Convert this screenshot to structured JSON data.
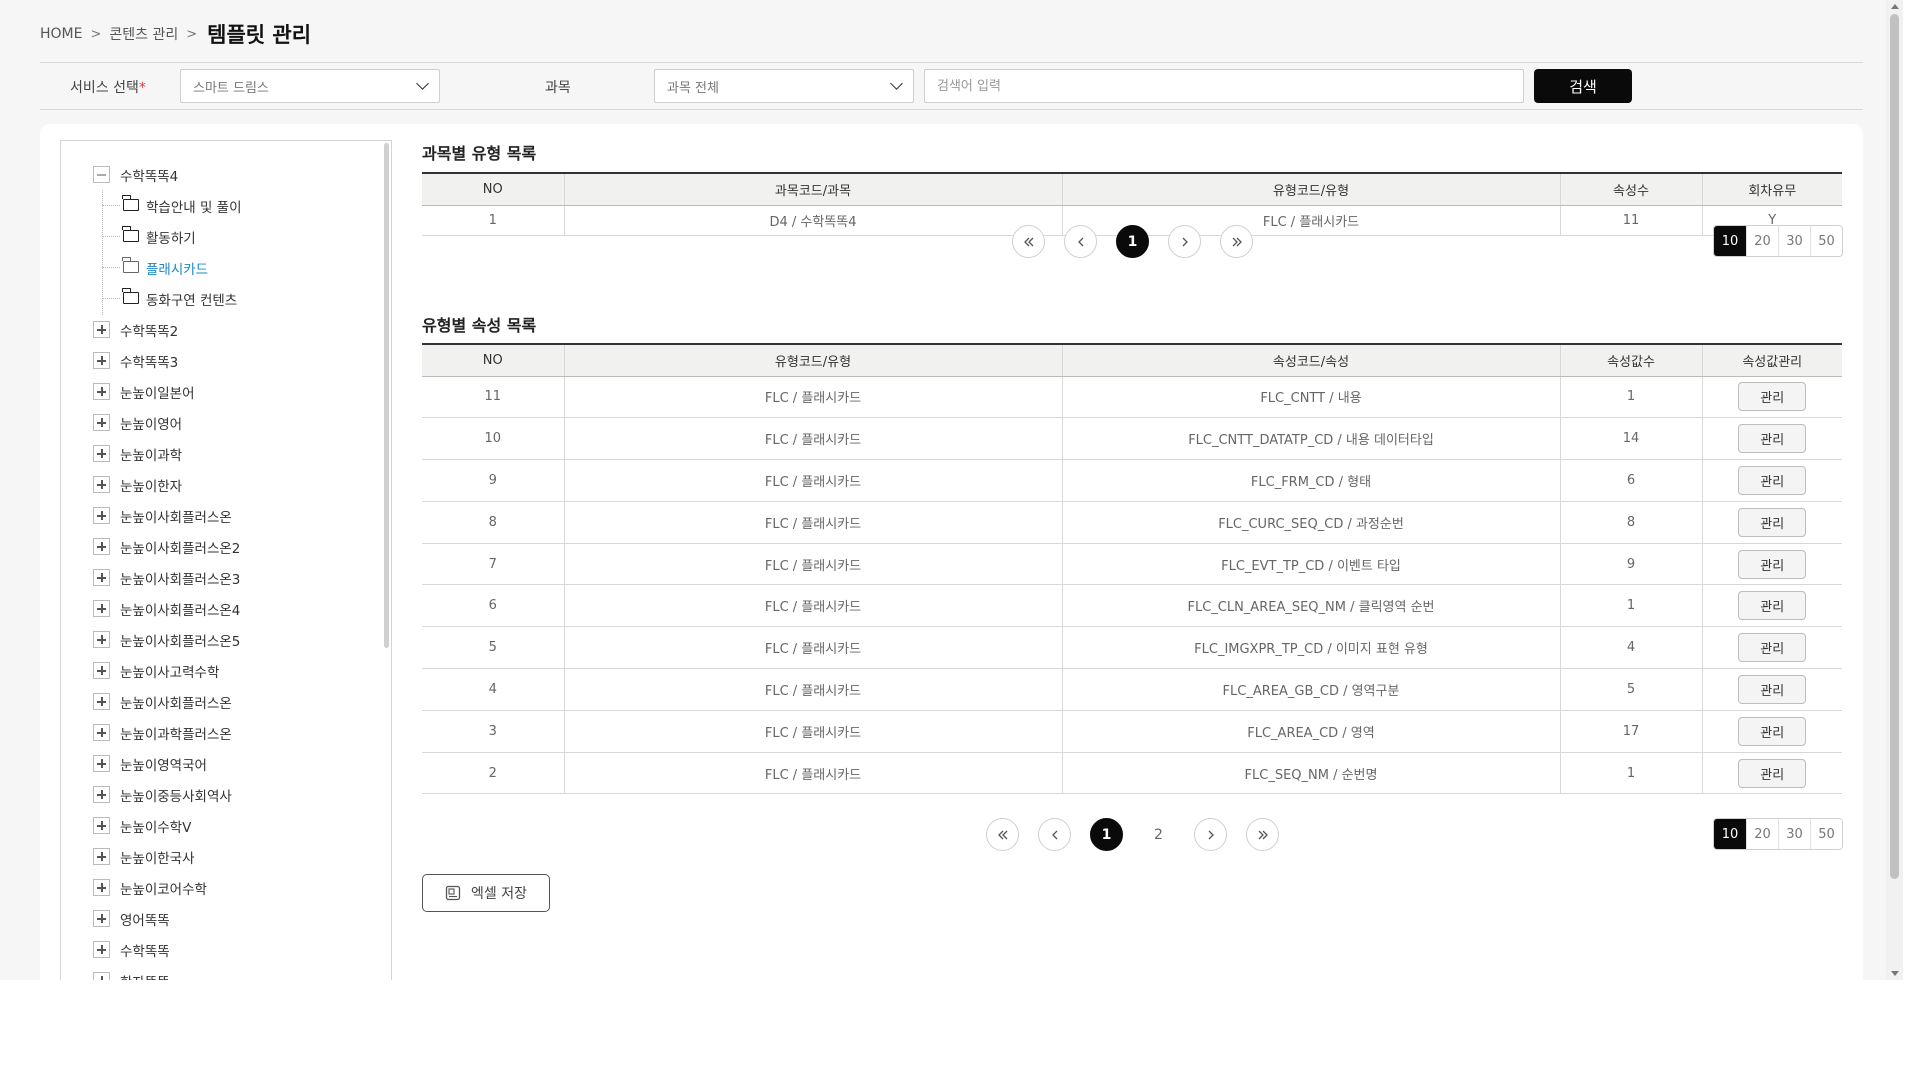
{
  "breadcrumb": {
    "home": "HOME",
    "sep": ">",
    "section": "콘텐츠 관리",
    "current": "템플릿 관리"
  },
  "filters": {
    "service_label": "서비스 선택",
    "required_mark": "*",
    "service_value": "스마트 드림스",
    "subject_label": "과목",
    "subject_value": "과목 전체",
    "keyword_placeholder": "검색어 입력",
    "search_button": "검색"
  },
  "tree": {
    "expanded": {
      "label": "수학똑똑4",
      "toggle": "minus"
    },
    "children": [
      {
        "label": "학습안내 및 풀이"
      },
      {
        "label": "활동하기"
      },
      {
        "label": "플래시카드",
        "active": true
      },
      {
        "label": "동화구연 컨텐츠"
      }
    ],
    "collapsed": [
      "수학똑똑2",
      "수학똑똑3",
      "눈높이일본어",
      "눈높이영어",
      "눈높이과학",
      "눈높이한자",
      "눈높이사회플러스온",
      "눈높이사회플러스온2",
      "눈높이사회플러스온3",
      "눈높이사회플러스온4",
      "눈높이사회플러스온5",
      "눈높이사고력수학",
      "눈높이사회플러스온",
      "눈높이과학플러스온",
      "눈높이영역국어",
      "눈높이중등사회역사",
      "눈높이수학V",
      "눈높이한국사",
      "눈높이코어수학",
      "영어똑똑",
      "수학똑똑",
      "한자똑똑"
    ]
  },
  "table1": {
    "title": "과목별 유형 목록",
    "headers": [
      "NO",
      "과목코드/과목",
      "유형코드/유형",
      "속성수",
      "회차유무"
    ],
    "rows": [
      [
        "1",
        "D4 / 수학똑똑4",
        "FLC / 플래시카드",
        "11",
        "Y"
      ]
    ],
    "pages": [
      "1"
    ],
    "current_page": "1",
    "page_sizes": [
      "10",
      "20",
      "30",
      "50"
    ],
    "current_size": "10"
  },
  "table2": {
    "title": "유형별 속성 목록",
    "headers": [
      "NO",
      "유형코드/유형",
      "속성코드/속성",
      "속성값수",
      "속성값관리"
    ],
    "manage_label": "관리",
    "rows": [
      [
        "11",
        "FLC / 플래시카드",
        "FLC_CNTT / 내용",
        "1"
      ],
      [
        "10",
        "FLC / 플래시카드",
        "FLC_CNTT_DATATP_CD / 내용 데이터타입",
        "14"
      ],
      [
        "9",
        "FLC / 플래시카드",
        "FLC_FRM_CD / 형태",
        "6"
      ],
      [
        "8",
        "FLC / 플래시카드",
        "FLC_CURC_SEQ_CD / 과정순번",
        "8"
      ],
      [
        "7",
        "FLC / 플래시카드",
        "FLC_EVT_TP_CD / 이벤트 타입",
        "9"
      ],
      [
        "6",
        "FLC / 플래시카드",
        "FLC_CLN_AREA_SEQ_NM / 클릭영역 순번",
        "1"
      ],
      [
        "5",
        "FLC / 플래시카드",
        "FLC_IMGXPR_TP_CD / 이미지 표현 유형",
        "4"
      ],
      [
        "4",
        "FLC / 플래시카드",
        "FLC_AREA_GB_CD / 영역구분",
        "5"
      ],
      [
        "3",
        "FLC / 플래시카드",
        "FLC_AREA_CD / 영역",
        "17"
      ],
      [
        "2",
        "FLC / 플래시카드",
        "FLC_SEQ_NM / 순번명",
        "1"
      ]
    ],
    "pages": [
      "1",
      "2"
    ],
    "current_page": "1",
    "page_sizes": [
      "10",
      "20",
      "30",
      "50"
    ],
    "current_size": "10"
  },
  "excel_button": "엑셀 저장",
  "colors": {
    "accent_dark": "#0a0a0a",
    "active_link": "#1e88c8",
    "required": "#e53935"
  }
}
